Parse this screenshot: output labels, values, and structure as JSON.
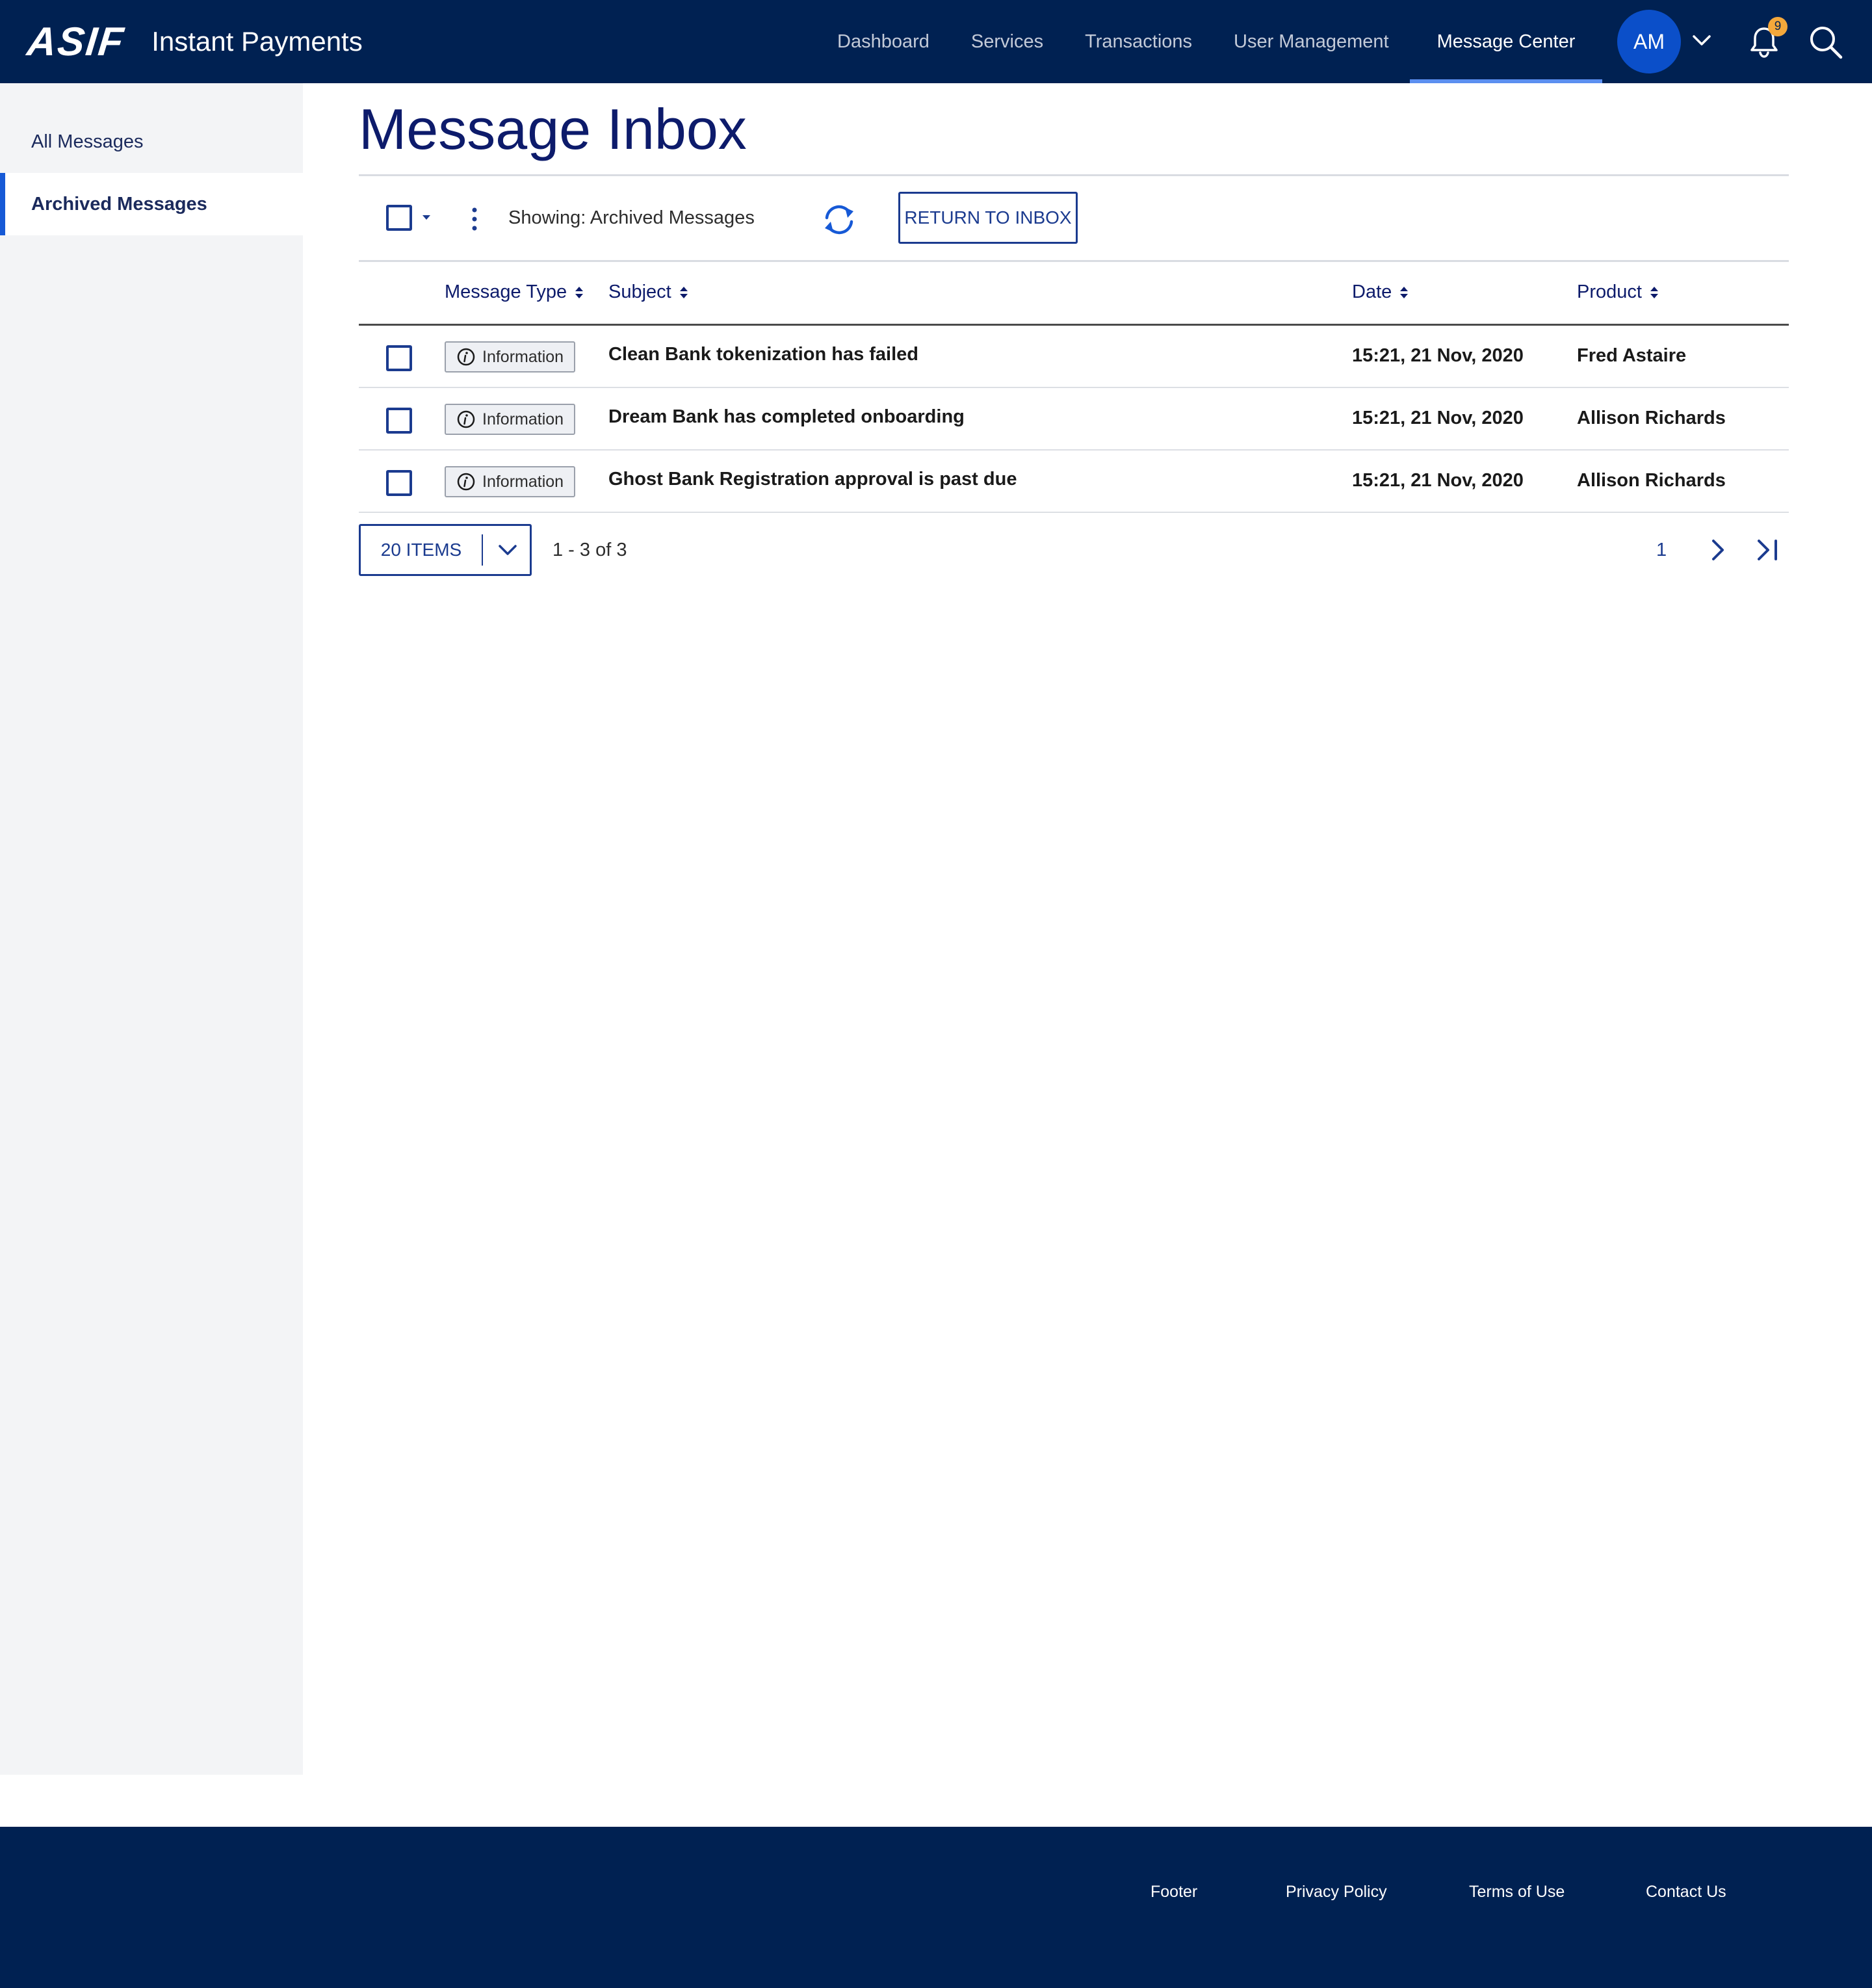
{
  "app": {
    "logo": "ASIF",
    "name": "Instant Payments"
  },
  "nav": {
    "items": [
      {
        "label": "Dashboard"
      },
      {
        "label": "Services"
      },
      {
        "label": "Transactions"
      },
      {
        "label": "User Management"
      },
      {
        "label": "Message Center",
        "active": true
      }
    ],
    "user_initials": "AM",
    "notification_count": "9",
    "icons": [
      "chevron-down-icon",
      "bell-icon",
      "search-icon"
    ]
  },
  "sidebar": {
    "items": [
      {
        "label": "All Messages"
      },
      {
        "label": "Archived Messages",
        "active": true
      }
    ]
  },
  "main": {
    "title": "Message Inbox",
    "toolbar": {
      "showing": "Showing: Archived Messages",
      "return_button": "RETURN TO INBOX"
    },
    "columns": {
      "type": "Message Type",
      "subject": "Subject",
      "date": "Date",
      "product": "Product"
    },
    "rows": [
      {
        "type": "Information",
        "subject": "Clean Bank tokenization has failed",
        "date": "15:21, 21 Nov, 2020",
        "product": "Fred Astaire"
      },
      {
        "type": "Information",
        "subject": "Dream Bank has completed onboarding",
        "date": "15:21, 21 Nov, 2020",
        "product": "Allison Richards"
      },
      {
        "type": "Information",
        "subject": "Ghost Bank Registration approval is past due",
        "date": "15:21, 21 Nov, 2020",
        "product": "Allison Richards"
      }
    ],
    "pagination": {
      "items_per_page": "20 ITEMS",
      "range": "1 - 3 of 3",
      "current_page": "1"
    }
  },
  "footer": {
    "links": [
      "Footer",
      "Privacy Policy",
      "Terms of Use",
      "Contact Us"
    ]
  },
  "colors": {
    "header_bg": "#002152",
    "accent": "#1659d6",
    "primary_text": "#0d1b6b",
    "badge_orange": "#f4a83b"
  }
}
